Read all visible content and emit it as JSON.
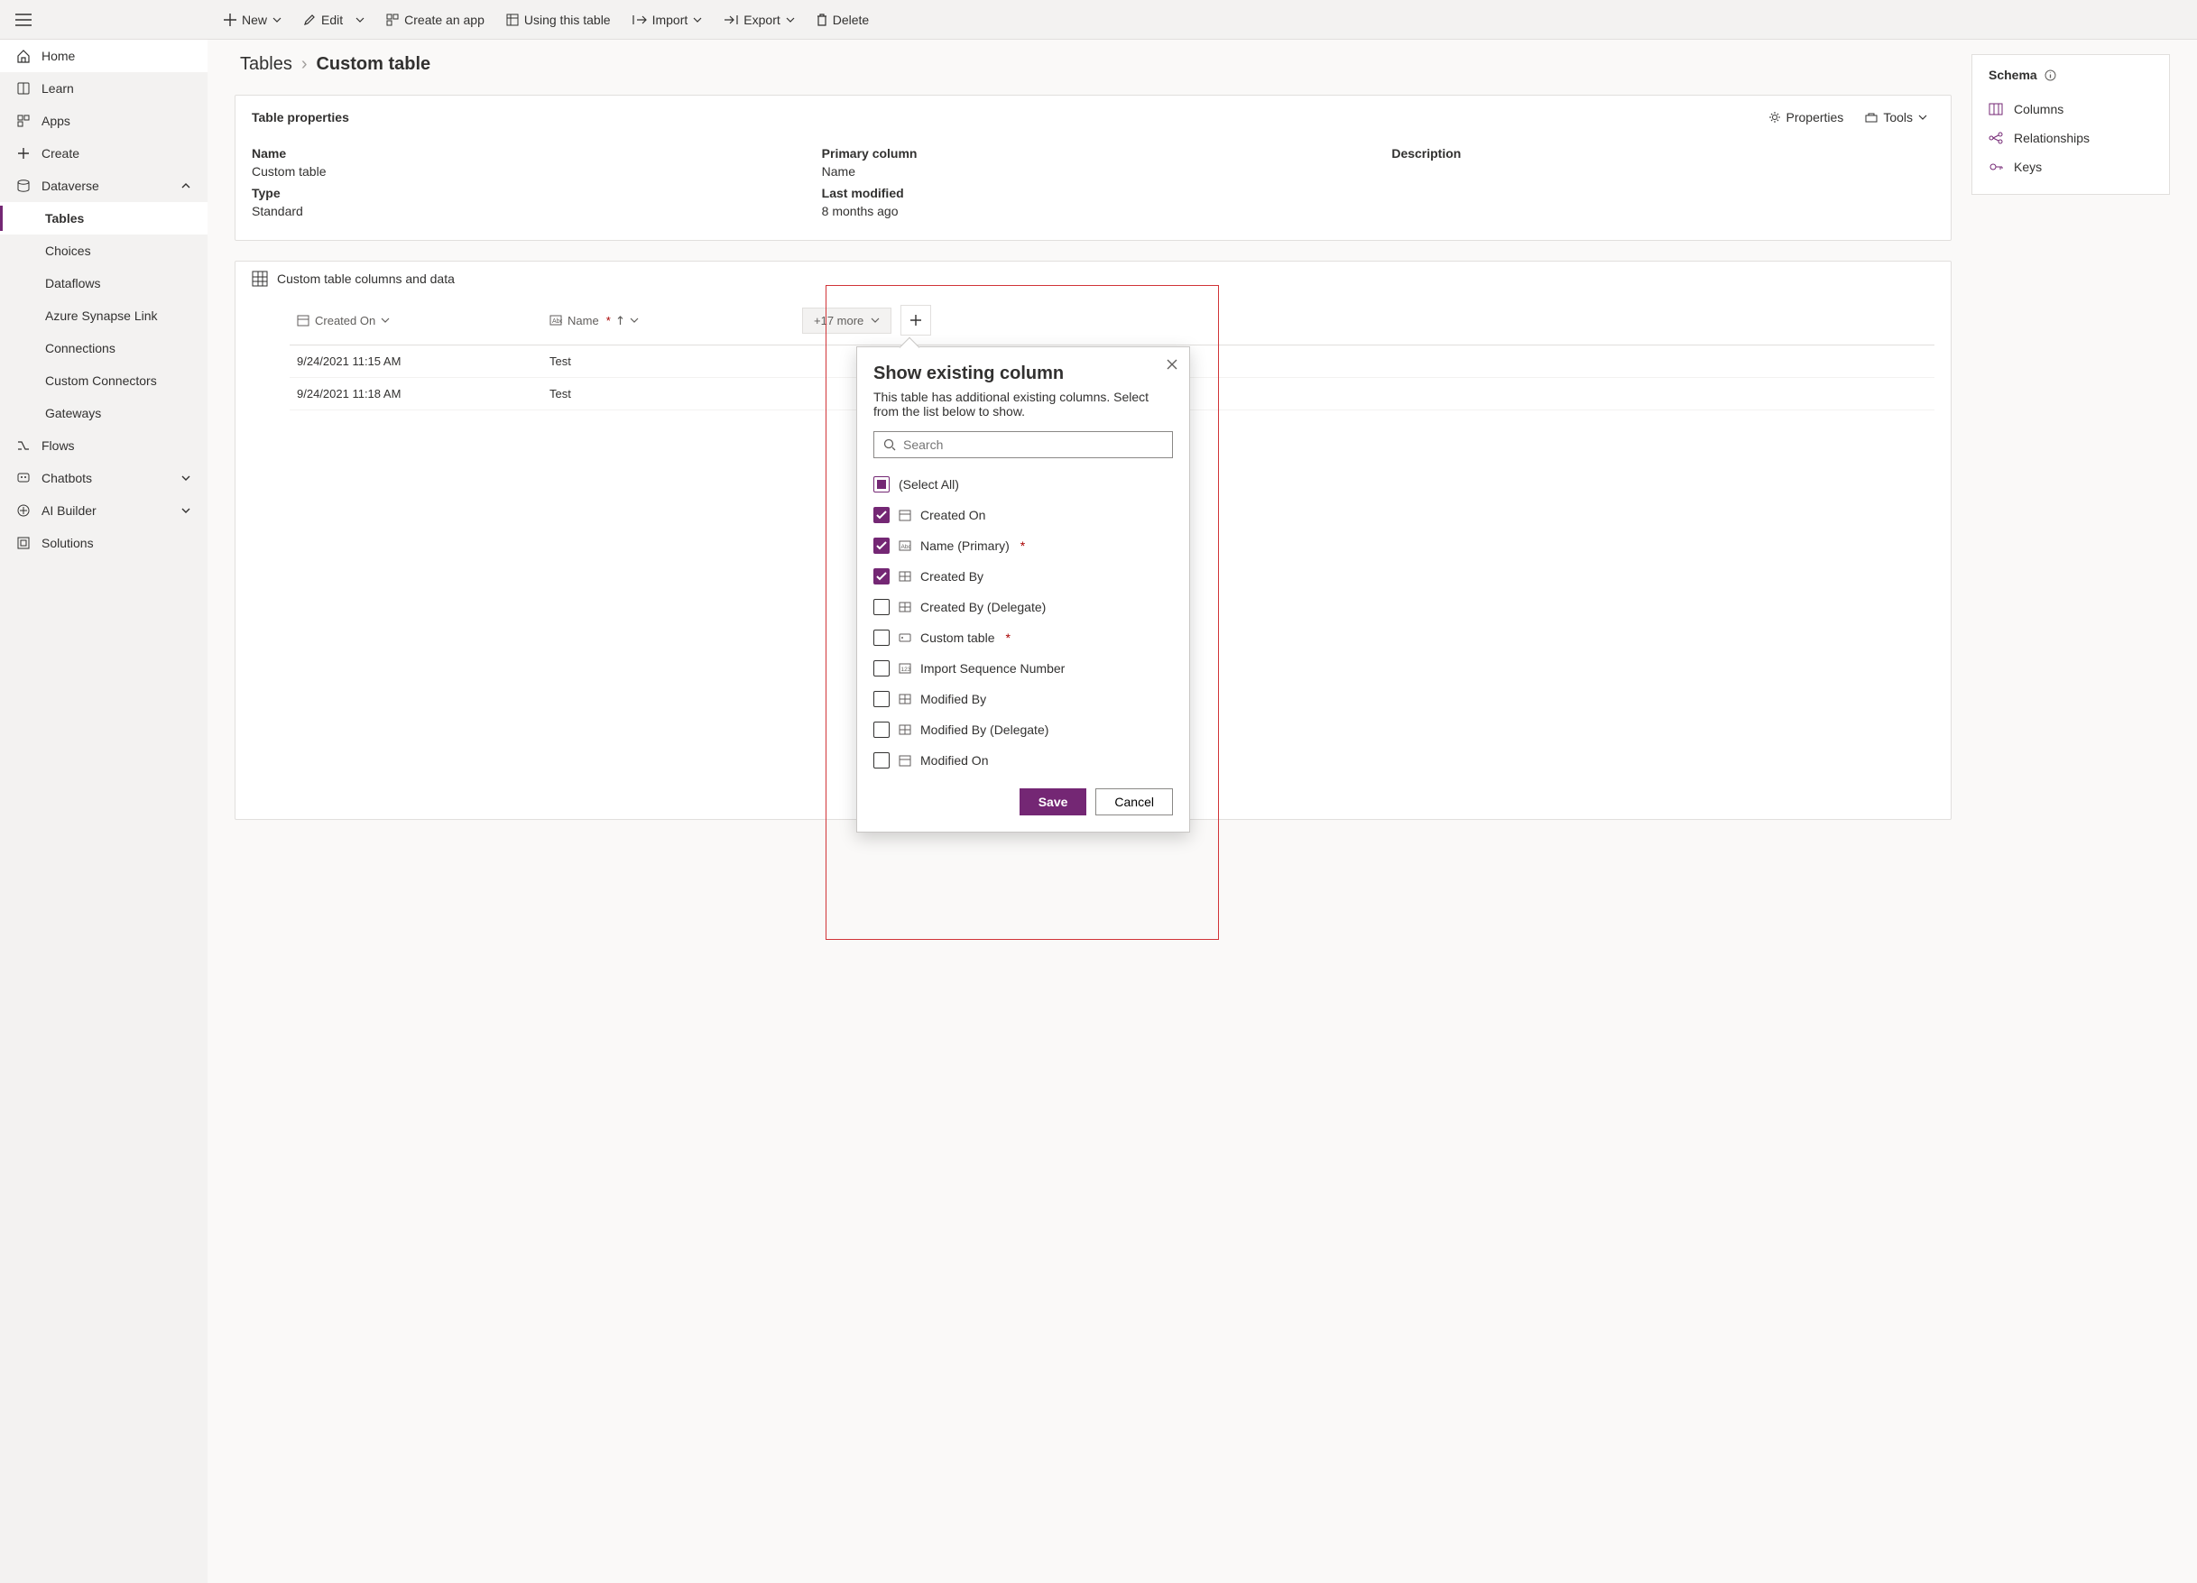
{
  "toolbar": {
    "new": "New",
    "edit": "Edit",
    "create_app": "Create an app",
    "using_table": "Using this table",
    "import": "Import",
    "export": "Export",
    "delete": "Delete"
  },
  "nav": {
    "home": "Home",
    "learn": "Learn",
    "apps": "Apps",
    "create": "Create",
    "dataverse": "Dataverse",
    "tables": "Tables",
    "choices": "Choices",
    "dataflows": "Dataflows",
    "synapse": "Azure Synapse Link",
    "connections": "Connections",
    "custom_connectors": "Custom Connectors",
    "gateways": "Gateways",
    "flows": "Flows",
    "chatbots": "Chatbots",
    "ai_builder": "AI Builder",
    "solutions": "Solutions"
  },
  "crumbs": {
    "root": "Tables",
    "current": "Custom table"
  },
  "table_props": {
    "title": "Table properties",
    "properties_btn": "Properties",
    "tools_btn": "Tools",
    "name_lbl": "Name",
    "name_val": "Custom table",
    "primary_lbl": "Primary column",
    "primary_val": "Name",
    "desc_lbl": "Description",
    "desc_val": "",
    "type_lbl": "Type",
    "type_val": "Standard",
    "lastmod_lbl": "Last modified",
    "lastmod_val": "8 months ago"
  },
  "schema": {
    "title": "Schema",
    "columns": "Columns",
    "relationships": "Relationships",
    "keys": "Keys"
  },
  "data": {
    "title": "Custom table columns and data",
    "col_created_on": "Created On",
    "col_name": "Name",
    "more_label": "+17 more",
    "rows": [
      {
        "created": "9/24/2021 11:15 AM",
        "name": "Test"
      },
      {
        "created": "9/24/2021 11:18 AM",
        "name": "Test"
      }
    ]
  },
  "popover": {
    "title": "Show existing column",
    "desc": "This table has additional existing columns. Select from the list below to show.",
    "search_placeholder": "Search",
    "select_all": "(Select All)",
    "save": "Save",
    "cancel": "Cancel",
    "columns": [
      {
        "label": "Created On",
        "icon": "date",
        "checked": true,
        "required": false
      },
      {
        "label": "Name (Primary)",
        "icon": "text",
        "checked": true,
        "required": true
      },
      {
        "label": "Created By",
        "icon": "lookup",
        "checked": true,
        "required": false
      },
      {
        "label": "Created By (Delegate)",
        "icon": "lookup",
        "checked": false,
        "required": false
      },
      {
        "label": "Custom table",
        "icon": "key",
        "checked": false,
        "required": true
      },
      {
        "label": "Import Sequence Number",
        "icon": "number",
        "checked": false,
        "required": false
      },
      {
        "label": "Modified By",
        "icon": "lookup",
        "checked": false,
        "required": false
      },
      {
        "label": "Modified By (Delegate)",
        "icon": "lookup",
        "checked": false,
        "required": false
      },
      {
        "label": "Modified On",
        "icon": "date",
        "checked": false,
        "required": false
      }
    ]
  }
}
